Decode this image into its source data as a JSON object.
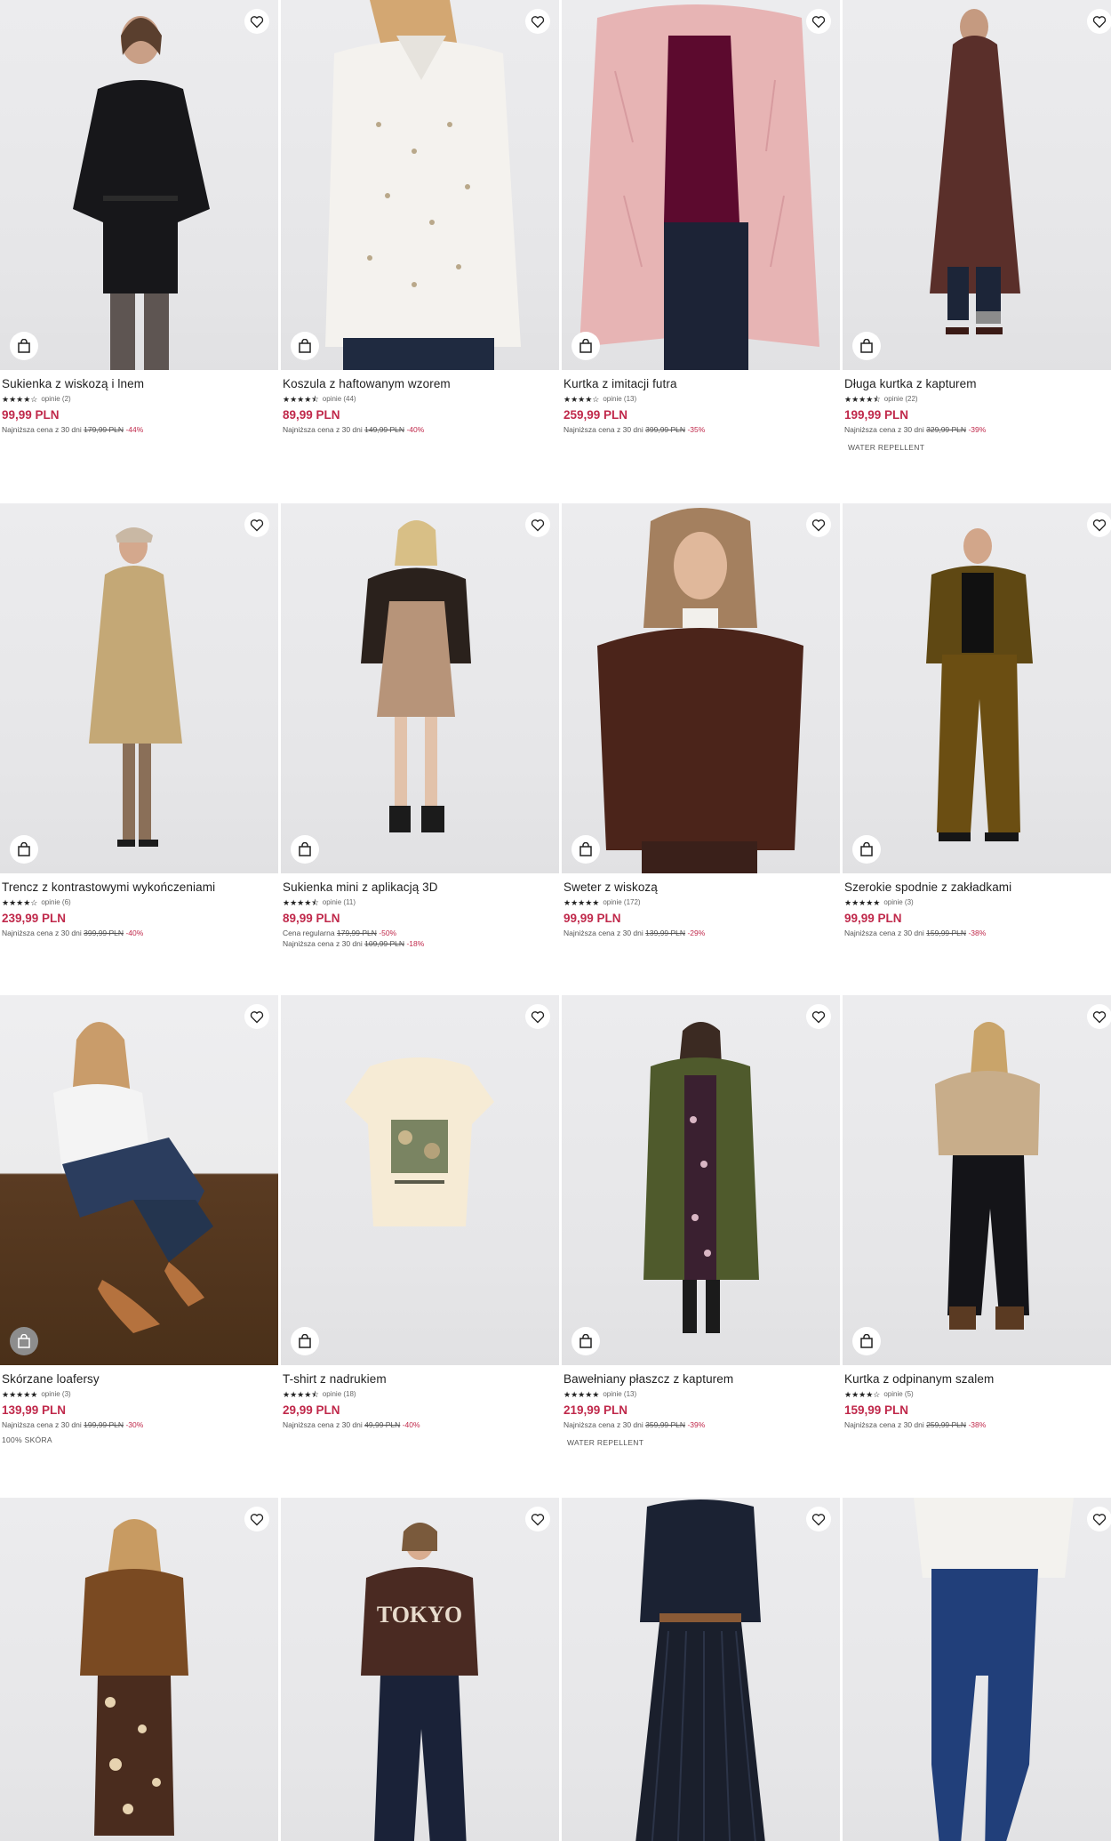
{
  "colors": {
    "accent_price": "#c0294b",
    "text": "#1f1f1f",
    "muted": "#555555"
  },
  "icons": {
    "favorite": "heart-outline-icon",
    "cart": "shopping-bag-icon"
  },
  "products": [
    {
      "name": "Sukienka z wiskozą i lnem",
      "stars": "★★★★☆",
      "reviews": "opinie (2)",
      "price": "99,99 PLN",
      "lowest_label": "Najniższa cena z 30 dni",
      "old_price": "179,99 PLN",
      "discount": "-44%",
      "tag": ""
    },
    {
      "name": "Koszula z haftowanym wzorem",
      "stars": "★★★★⯪",
      "reviews": "opinie (44)",
      "price": "89,99 PLN",
      "lowest_label": "Najniższa cena z 30 dni",
      "old_price": "149,99 PLN",
      "discount": "-40%",
      "tag": ""
    },
    {
      "name": "Kurtka z imitacji futra",
      "stars": "★★★★☆",
      "reviews": "opinie (13)",
      "price": "259,99 PLN",
      "lowest_label": "Najniższa cena z 30 dni",
      "old_price": "399,99 PLN",
      "discount": "-35%",
      "tag": ""
    },
    {
      "name": "Długa kurtka z kapturem",
      "stars": "★★★★⯪",
      "reviews": "opinie (22)",
      "price": "199,99 PLN",
      "lowest_label": "Najniższa cena z 30 dni",
      "old_price": "329,99 PLN",
      "discount": "-39%",
      "tag": "WATER REPELLENT"
    },
    {
      "name": "Trencz z kontrastowymi wykończeniami",
      "stars": "★★★★☆",
      "reviews": "opinie (6)",
      "price": "239,99 PLN",
      "lowest_label": "Najniższa cena z 30 dni",
      "old_price": "399,99 PLN",
      "discount": "-40%",
      "tag": ""
    },
    {
      "name": "Sukienka mini z aplikacją 3D",
      "stars": "★★★★⯪",
      "reviews": "opinie (11)",
      "price": "89,99 PLN",
      "regular_label": "Cena regularna",
      "regular_price": "179,99 PLN",
      "regular_discount": "-50%",
      "lowest_label": "Najniższa cena z 30 dni",
      "old_price": "109,99 PLN",
      "discount": "-18%",
      "tag": ""
    },
    {
      "name": "Sweter z wiskozą",
      "stars": "★★★★★",
      "reviews": "opinie (172)",
      "price": "99,99 PLN",
      "lowest_label": "Najniższa cena z 30 dni",
      "old_price": "139,99 PLN",
      "discount": "-29%",
      "tag": ""
    },
    {
      "name": "Szerokie spodnie z zakładkami",
      "stars": "★★★★★",
      "reviews": "opinie (3)",
      "price": "99,99 PLN",
      "lowest_label": "Najniższa cena z 30 dni",
      "old_price": "159,99 PLN",
      "discount": "-38%",
      "tag": ""
    },
    {
      "name": "Skórzane loafersy",
      "stars": "★★★★★",
      "reviews": "opinie (3)",
      "price": "139,99 PLN",
      "lowest_label": "Najniższa cena z 30 dni",
      "old_price": "199,99 PLN",
      "discount": "-30%",
      "tag": "100% SKÓRA"
    },
    {
      "name": "T-shirt z nadrukiem",
      "stars": "★★★★⯪",
      "reviews": "opinie (18)",
      "price": "29,99 PLN",
      "lowest_label": "Najniższa cena z 30 dni",
      "old_price": "49,99 PLN",
      "discount": "-40%",
      "tag": ""
    },
    {
      "name": "Bawełniany płaszcz z kapturem",
      "stars": "★★★★★",
      "reviews": "opinie (13)",
      "price": "219,99 PLN",
      "lowest_label": "Najniższa cena z 30 dni",
      "old_price": "359,99 PLN",
      "discount": "-39%",
      "tag": "WATER REPELLENT"
    },
    {
      "name": "Kurtka z odpinanym szalem",
      "stars": "★★★★☆",
      "reviews": "opinie (5)",
      "price": "159,99 PLN",
      "lowest_label": "Najniższa cena z 30 dni",
      "old_price": "259,99 PLN",
      "discount": "-38%",
      "tag": ""
    },
    {
      "name": "",
      "stars": "",
      "reviews": "",
      "price": "",
      "lowest_label": "",
      "old_price": "",
      "discount": "",
      "tag": ""
    },
    {
      "name": "",
      "stars": "",
      "reviews": "",
      "price": "",
      "lowest_label": "",
      "old_price": "",
      "discount": "",
      "tag": ""
    },
    {
      "name": "",
      "stars": "",
      "reviews": "",
      "price": "",
      "lowest_label": "",
      "old_price": "",
      "discount": "",
      "tag": ""
    },
    {
      "name": "",
      "stars": "",
      "reviews": "",
      "price": "",
      "lowest_label": "",
      "old_price": "",
      "discount": "",
      "tag": ""
    }
  ]
}
